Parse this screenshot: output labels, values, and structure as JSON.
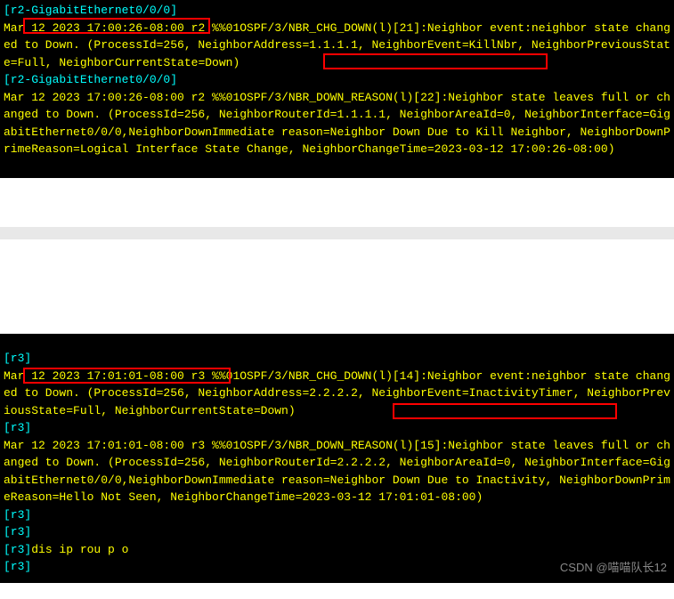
{
  "terminal1": {
    "line1": "[r2-GigabitEthernet0/0/0]",
    "line2_part1": "Mar",
    "line2_boxed": " 12 2023 17:00:26-08:00 ",
    "line2_part2": "r2 %%01OSPF/3/NBR_CHG_DOWN(l)[21]:Neighbor event:neighbor state changed to Down. (ProcessId=256, NeighborAddress=1.1.1.1, NeighborEvent=KillNbr, NeighborPreviousState=Full, ",
    "line2_boxed2": "NeighborCurrentState=Down)",
    "line3": "[r2-GigabitEthernet0/0/0]",
    "line4": "Mar 12 2023 17:00:26-08:00 r2 %%01OSPF/3/NBR_DOWN_REASON(l)[22]:Neighbor state leaves full or changed to Down. (ProcessId=256, NeighborRouterId=1.1.1.1, NeighborAreaId=0, NeighborInterface=GigabitEthernet0/0/0,NeighborDownImmediate reason=Neighbor Down Due to Kill Neighbor, NeighborDownPrimeReason=Logical Interface State Change, NeighborChangeTime=2023-03-12 17:00:26-08:00)"
  },
  "terminal2": {
    "line1": "[r3]",
    "line2_part1": "Mar",
    "line2_boxed": " 12 2023 17:01:01-08:00 ",
    "line2_part2": "r3 %%01OSPF/3/NBR_CHG_DOWN(l)[14]:Neighbor event:neighbor state changed to Down. (ProcessId=256, NeighborAddress=2.2.2.2, NeighborEvent=InactivityTimer, NeighborPreviousState=Full, ",
    "line2_boxed2": "NeighborCurrentState=Down)",
    "line3": "[r3]",
    "line4": "Mar 12 2023 17:01:01-08:00 r3 %%01OSPF/3/NBR_DOWN_REASON(l)[15]:Neighbor state leaves full or changed to Down. (ProcessId=256, NeighborRouterId=2.2.2.2, NeighborAreaId=0, NeighborInterface=GigabitEthernet0/0/0,NeighborDownImmediate reason=Neighbor Down Due to Inactivity, NeighborDownPrimeReason=Hello Not Seen, NeighborChangeTime=2023-03-12 17:01:01-08:00)",
    "line5": "[r3]",
    "line6": "[r3]",
    "line7_prompt": "[r3]",
    "line7_cmd": "dis ip rou p o",
    "line8": "[r3]"
  },
  "watermark": "CSDN @喵喵队长12"
}
